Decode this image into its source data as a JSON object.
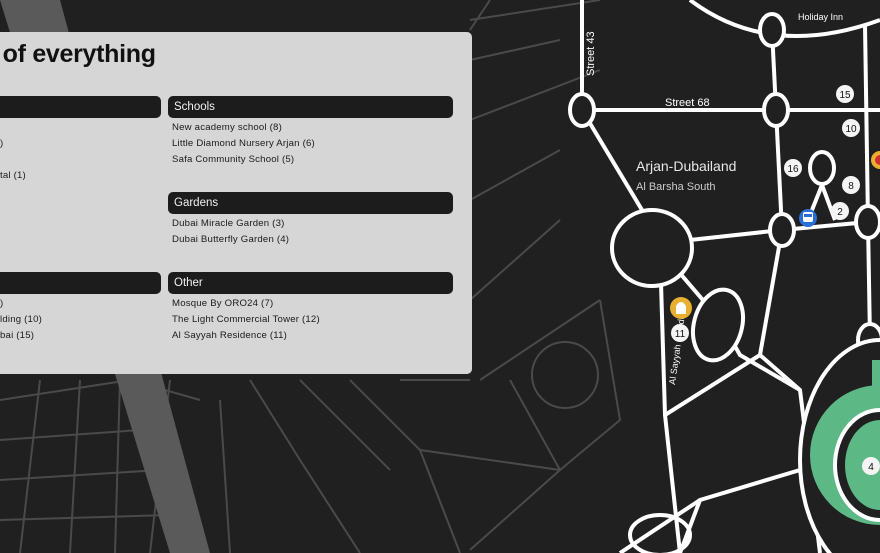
{
  "panel": {
    "title": "t of everything",
    "sections": [
      {
        "header": "",
        "items": [
          "",
          ")",
          "",
          "tal (1)"
        ]
      },
      {
        "header": "Schools",
        "items": [
          "New academy school (8)",
          "Little Diamond Nursery Arjan (6)",
          "Safa Community School (5)"
        ]
      },
      {
        "header": "Gardens",
        "items": [
          "Dubai Miracle Garden (3)",
          "Dubai Butterfly Garden (4)"
        ]
      },
      {
        "header": "",
        "items": [
          ")",
          "lding (10)",
          "bai (15)"
        ]
      },
      {
        "header": "Other",
        "items": [
          "Mosque By ORO24 (7)",
          "The Light Commercial Tower (12)",
          "Al Sayyah Residence (11)"
        ]
      }
    ]
  },
  "map": {
    "labels": {
      "street43": "Street 43",
      "street68": "Street 68",
      "area": "Arjan-Dubailand",
      "subarea": "Al Barsha South",
      "holiday": "Holiday Inn",
      "sayyah": "Al Sayyah Residence"
    },
    "markers": [
      "15",
      "10",
      "16",
      "8",
      "2",
      "11",
      "4"
    ],
    "colors": {
      "background": "#202020",
      "road_major": "#ffffff",
      "road_minor": "#4a4a4a",
      "park": "#5cb884",
      "marker_bg": "#f4f4f4"
    },
    "icons": [
      "bus-stop-icon",
      "mosque-icon",
      "poi-badge-icon"
    ]
  }
}
